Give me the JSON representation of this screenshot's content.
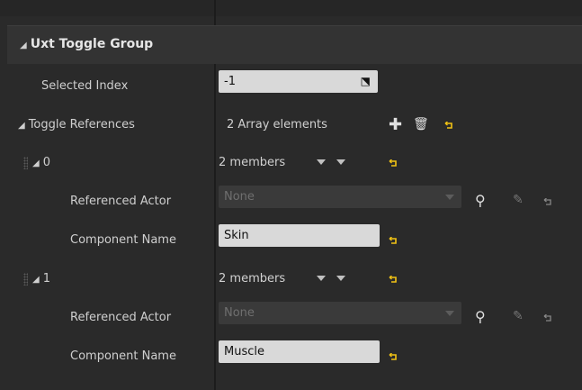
{
  "section": {
    "title": "Uxt Toggle Group"
  },
  "selected_index": {
    "label": "Selected Index",
    "value": "-1"
  },
  "toggle_references": {
    "label": "Toggle References",
    "summary": "2 Array elements"
  },
  "elements": [
    {
      "index": "0",
      "summary": "2 members",
      "referenced_actor_label": "Referenced Actor",
      "referenced_actor_value": "None",
      "component_name_label": "Component Name",
      "component_name_value": "Skin"
    },
    {
      "index": "1",
      "summary": "2 members",
      "referenced_actor_label": "Referenced Actor",
      "referenced_actor_value": "None",
      "component_name_label": "Component Name",
      "component_name_value": "Muscle"
    }
  ],
  "colors": {
    "reset_arrow": "#f2c314",
    "panel_bg": "#2a2a2a",
    "field_bg": "#d9d9d9"
  }
}
